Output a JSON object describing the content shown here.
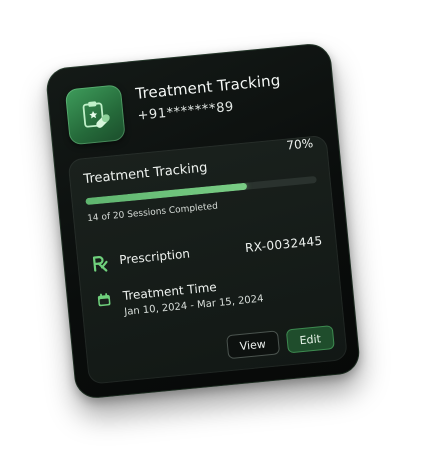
{
  "header": {
    "title": "Treatment Tracking",
    "phone": "+91*******89",
    "icon": "clipboard-pill-icon"
  },
  "progress": {
    "label": "Treatment Tracking",
    "percent_text": "70%",
    "fraction": 0.7,
    "sessions_text": "14 of 20 Sessions Completed"
  },
  "prescription": {
    "icon": "rx-icon",
    "label": "Prescription",
    "value": "RX-0032445"
  },
  "treatment_time": {
    "icon": "calendar-icon",
    "label": "Treatment Time",
    "range": "Jan 10, 2024 - Mar 15, 2024"
  },
  "actions": {
    "view_label": "View",
    "edit_label": "Edit"
  },
  "colors": {
    "accent": "#6fd07c",
    "card_bg": "#0b0e0c",
    "edit_bg": "#1f4d2c"
  }
}
